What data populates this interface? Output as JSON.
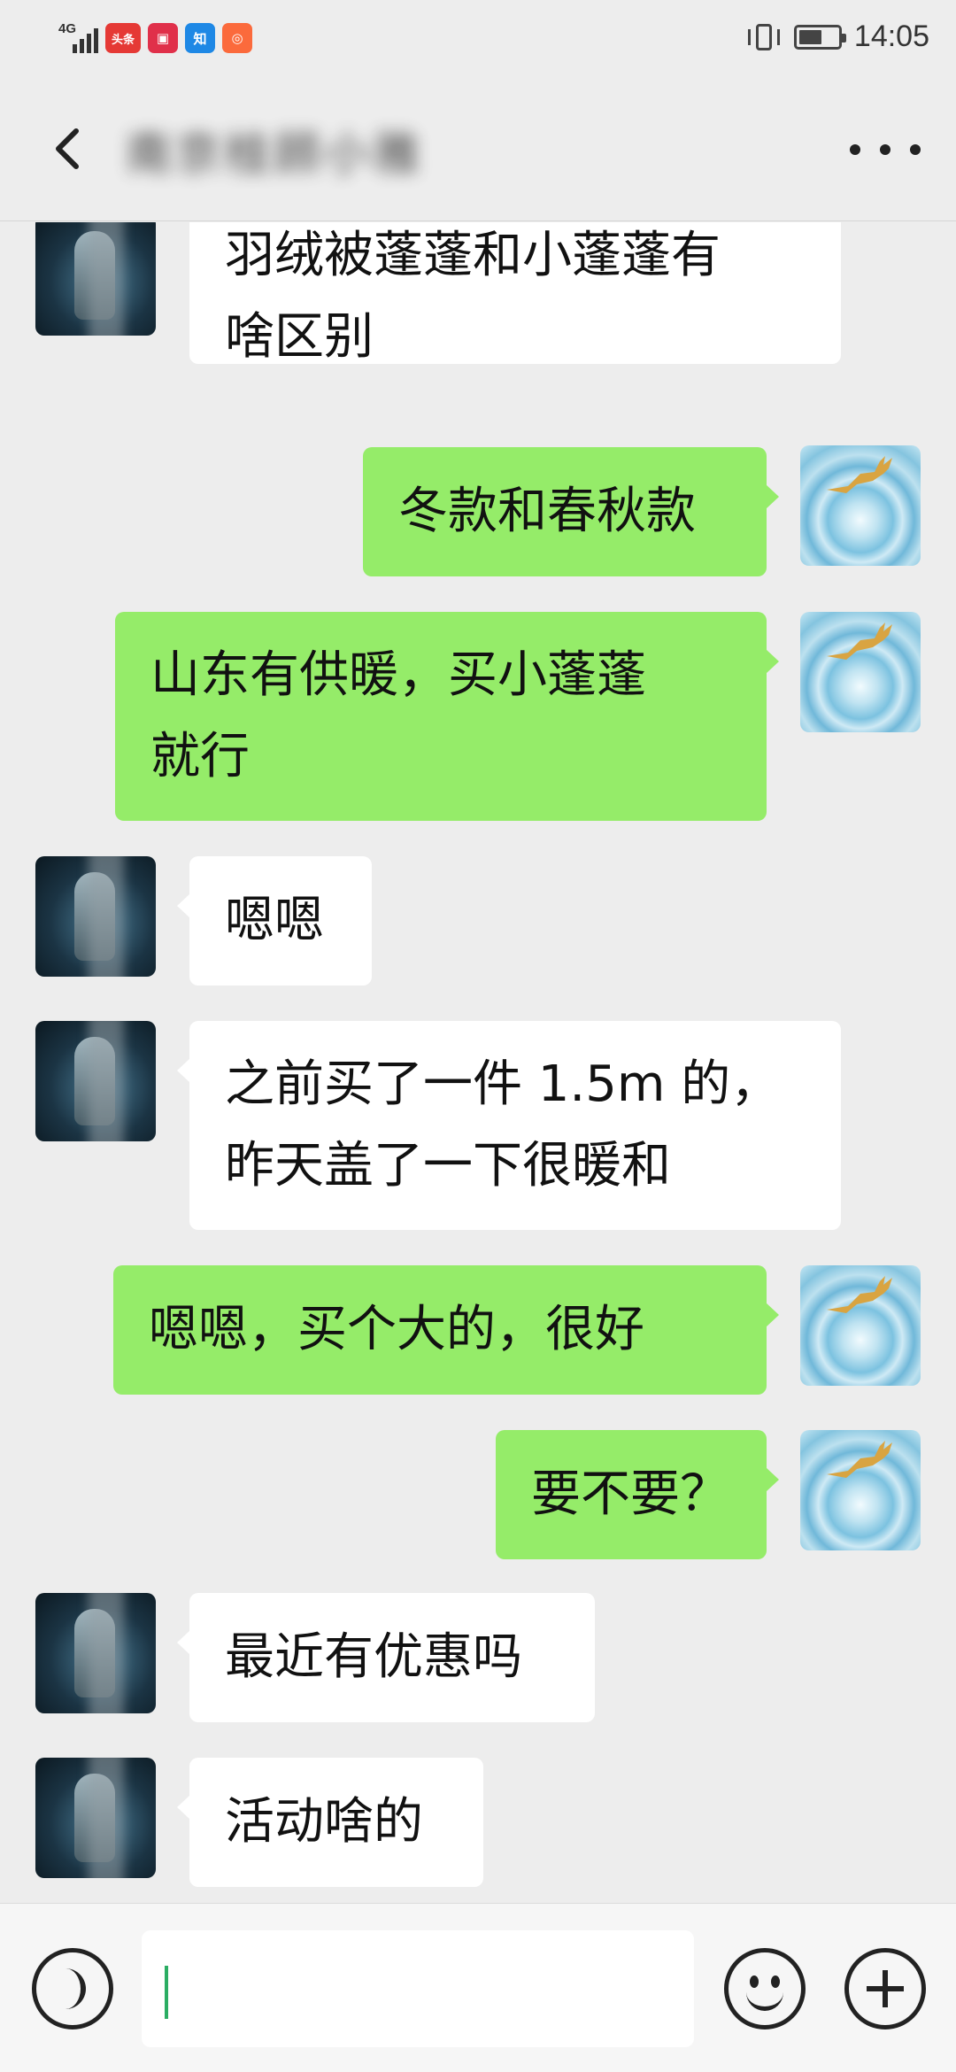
{
  "status_bar": {
    "network": "4G",
    "apps": [
      {
        "label": "头条",
        "color": "#e53935"
      },
      {
        "label": "▣",
        "color": "#e0304a"
      },
      {
        "label": "知",
        "color": "#1e88e5"
      },
      {
        "label": "◎",
        "color": "#fb6a3c"
      }
    ],
    "time": "14:05"
  },
  "header": {
    "title": "南京桂顾小雅",
    "back_icon": "chevron-left-icon",
    "more_icon": "more-dots-icon"
  },
  "messages": [
    {
      "from": "them",
      "text": "羽绒被蓬蓬和小蓬蓬有\n啥区别"
    },
    {
      "from": "me",
      "text": "冬款和春秋款"
    },
    {
      "from": "me",
      "text": "山东有供暖，买小蓬蓬\n就行"
    },
    {
      "from": "them",
      "text": "嗯嗯"
    },
    {
      "from": "them",
      "text": "之前买了一件 1.5m 的，\n昨天盖了一下很暖和"
    },
    {
      "from": "me",
      "text": "嗯嗯，买个大的，很好"
    },
    {
      "from": "me",
      "text": "要不要？"
    },
    {
      "from": "them",
      "text": "最近有优惠吗"
    },
    {
      "from": "them",
      "text": "活动啥的"
    }
  ],
  "input_bar": {
    "voice_icon": "voice-icon",
    "emoji_icon": "emoji-icon",
    "plus_icon": "plus-icon",
    "input_value": ""
  },
  "colors": {
    "background": "#ededed",
    "bubble_me": "#95ec69",
    "bubble_them": "#ffffff",
    "caret": "#2bad63"
  }
}
